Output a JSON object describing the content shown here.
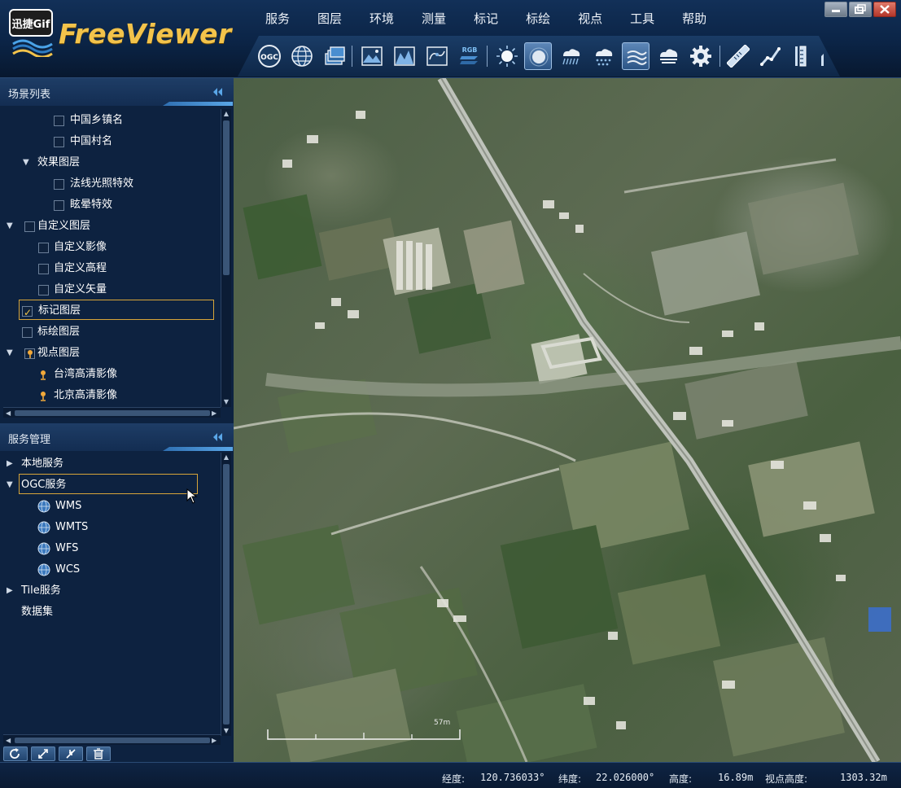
{
  "gif_badge": "迅捷Gif",
  "app": {
    "title": "FreeViewer"
  },
  "menu": [
    "服务",
    "图层",
    "环境",
    "测量",
    "标记",
    "标绘",
    "视点",
    "工具",
    "帮助"
  ],
  "toolbar": {
    "tools": [
      "ogc-icon",
      "globe-icon",
      "layers-icon",
      "image-layer-icon",
      "terrain-icon",
      "vector-icon",
      "rgb-icon",
      "sun-icon",
      "atmosphere-icon",
      "rain-icon",
      "snow-icon",
      "fog-icon",
      "cloud-icon",
      "settings-icon",
      "ruler-icon",
      "path-measure-icon",
      "height-measure-icon",
      "more-icon"
    ],
    "ogc_label": "OGC",
    "rgb_label": "RGB",
    "active": [
      "atmosphere-icon",
      "fog-icon"
    ]
  },
  "scene_panel": {
    "title": "场景列表",
    "items": [
      {
        "label": "中国乡镇名",
        "checked": false
      },
      {
        "label": "中国村名",
        "checked": false
      },
      {
        "label": "效果图层",
        "expanded": true
      },
      {
        "label": "法线光照特效",
        "checked": false
      },
      {
        "label": "眩晕特效",
        "checked": false
      },
      {
        "label": "自定义图层",
        "checked": false,
        "expanded": true
      },
      {
        "label": "自定义影像",
        "checked": false
      },
      {
        "label": "自定义高程",
        "checked": false
      },
      {
        "label": "自定义矢量",
        "checked": false
      },
      {
        "label": "标记图层",
        "checked": true,
        "selected": true
      },
      {
        "label": "标绘图层",
        "checked": false
      },
      {
        "label": "视点图层",
        "expanded": true
      },
      {
        "label": "台湾高清影像"
      },
      {
        "label": "北京高清影像"
      }
    ]
  },
  "service_panel": {
    "title": "服务管理",
    "items": [
      {
        "label": "本地服务",
        "expanded": false
      },
      {
        "label": "OGC服务",
        "expanded": true,
        "selected": true
      },
      {
        "label": "WMS"
      },
      {
        "label": "WMTS"
      },
      {
        "label": "WFS"
      },
      {
        "label": "WCS"
      },
      {
        "label": "Tile服务",
        "expanded": false
      },
      {
        "label": "数据集"
      }
    ]
  },
  "bottom_tools": [
    "refresh-icon",
    "expand-icon",
    "collapse-icon",
    "delete-icon"
  ],
  "map": {
    "scale_label": "57m"
  },
  "status": {
    "lon_label": "经度:",
    "lon_value": "120.736033°",
    "lat_label": "纬度:",
    "lat_value": "22.026000°",
    "alt_label": "高度:",
    "alt_value": "16.89m",
    "eye_label": "视点高度:",
    "eye_value": "1303.32m"
  },
  "colors": {
    "accent": "#f3c34b",
    "selection": "#d7a53a",
    "panel": "#0d2240",
    "header": "#132d52"
  }
}
